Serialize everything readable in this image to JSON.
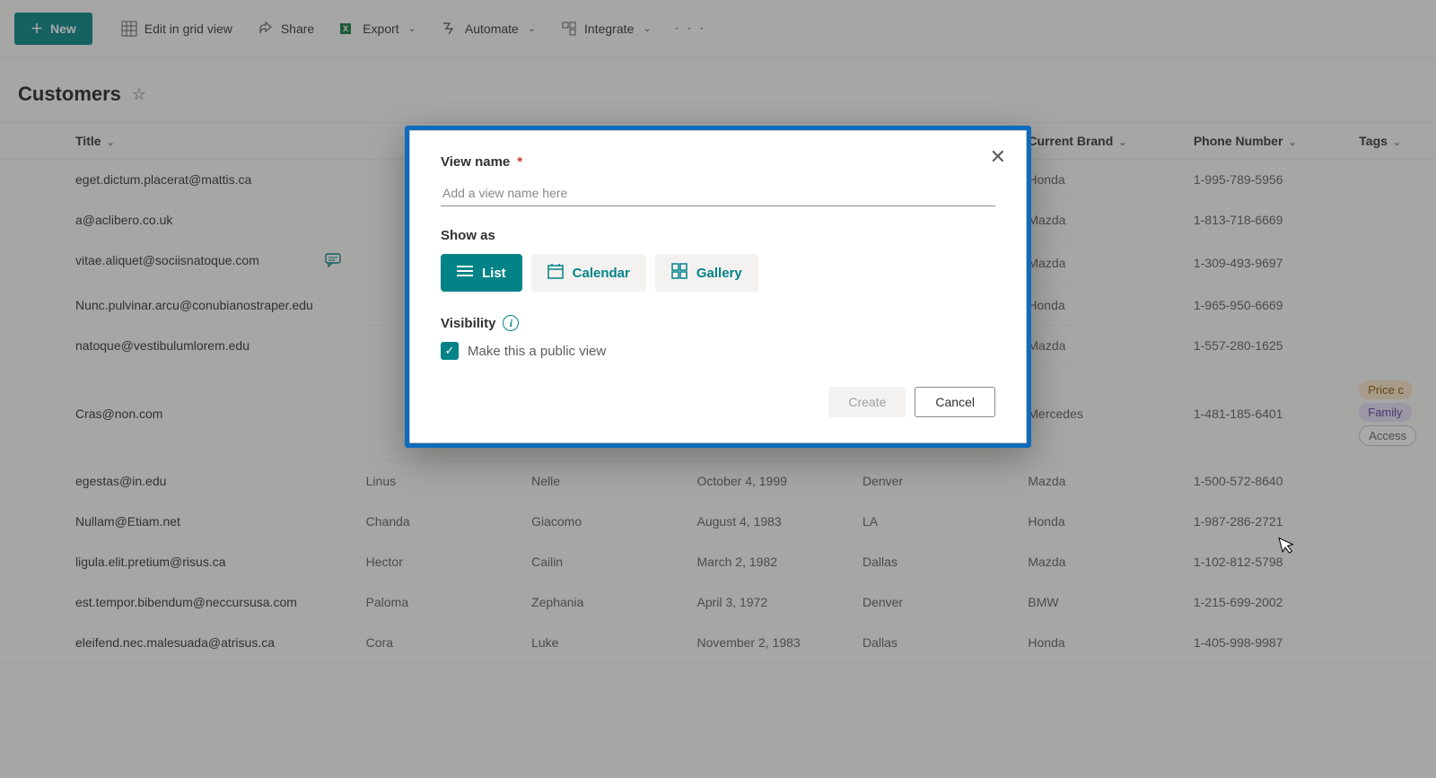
{
  "toolbar": {
    "new_label": "New",
    "edit_grid_label": "Edit in grid view",
    "share_label": "Share",
    "export_label": "Export",
    "automate_label": "Automate",
    "integrate_label": "Integrate"
  },
  "list": {
    "title": "Customers"
  },
  "columns": {
    "title": "Title",
    "first_name": "",
    "last_name": "",
    "dob": "",
    "city": "",
    "current_brand": "Current Brand",
    "phone": "Phone Number",
    "tags": "Tags"
  },
  "rows": [
    {
      "title": "eget.dictum.placerat@mattis.ca",
      "first": "",
      "last": "",
      "dob": "",
      "city": "",
      "brand": "Honda",
      "phone": "1-995-789-5956",
      "tags": [],
      "memo": false
    },
    {
      "title": "a@aclibero.co.uk",
      "first": "",
      "last": "",
      "dob": "",
      "city": "",
      "brand": "Mazda",
      "phone": "1-813-718-6669",
      "tags": [],
      "memo": false
    },
    {
      "title": "vitae.aliquet@sociisnatoque.com",
      "first": "",
      "last": "",
      "dob": "",
      "city": "",
      "brand": "Mazda",
      "phone": "1-309-493-9697",
      "tags": [],
      "memo": true
    },
    {
      "title": "Nunc.pulvinar.arcu@conubianostraper.edu",
      "first": "",
      "last": "",
      "dob": "",
      "city": "",
      "brand": "Honda",
      "phone": "1-965-950-6669",
      "tags": [],
      "memo": false
    },
    {
      "title": "natoque@vestibulumlorem.edu",
      "first": "",
      "last": "",
      "dob": "",
      "city": "",
      "brand": "Mazda",
      "phone": "1-557-280-1625",
      "tags": [],
      "memo": false
    },
    {
      "title": "Cras@non.com",
      "first": "",
      "last": "",
      "dob": "",
      "city": "",
      "brand": "Mercedes",
      "phone": "1-481-185-6401",
      "tags": [
        "Price c",
        "Family",
        "Access"
      ],
      "memo": false
    },
    {
      "title": "egestas@in.edu",
      "first": "Linus",
      "last": "Nelle",
      "dob": "October 4, 1999",
      "city": "Denver",
      "brand": "Mazda",
      "phone": "1-500-572-8640",
      "tags": [],
      "memo": false
    },
    {
      "title": "Nullam@Etiam.net",
      "first": "Chanda",
      "last": "Giacomo",
      "dob": "August 4, 1983",
      "city": "LA",
      "brand": "Honda",
      "phone": "1-987-286-2721",
      "tags": [],
      "memo": false
    },
    {
      "title": "ligula.elit.pretium@risus.ca",
      "first": "Hector",
      "last": "Cailin",
      "dob": "March 2, 1982",
      "city": "Dallas",
      "brand": "Mazda",
      "phone": "1-102-812-5798",
      "tags": [],
      "memo": false
    },
    {
      "title": "est.tempor.bibendum@neccursusa.com",
      "first": "Paloma",
      "last": "Zephania",
      "dob": "April 3, 1972",
      "city": "Denver",
      "brand": "BMW",
      "phone": "1-215-699-2002",
      "tags": [],
      "memo": false
    },
    {
      "title": "eleifend.nec.malesuada@atrisus.ca",
      "first": "Cora",
      "last": "Luke",
      "dob": "November 2, 1983",
      "city": "Dallas",
      "brand": "Honda",
      "phone": "1-405-998-9987",
      "tags": [],
      "memo": false
    }
  ],
  "modal": {
    "view_name_label": "View name",
    "view_name_placeholder": "Add a view name here",
    "show_as_label": "Show as",
    "option_list": "List",
    "option_calendar": "Calendar",
    "option_gallery": "Gallery",
    "visibility_label": "Visibility",
    "public_view_label": "Make this a public view",
    "create_label": "Create",
    "cancel_label": "Cancel"
  }
}
